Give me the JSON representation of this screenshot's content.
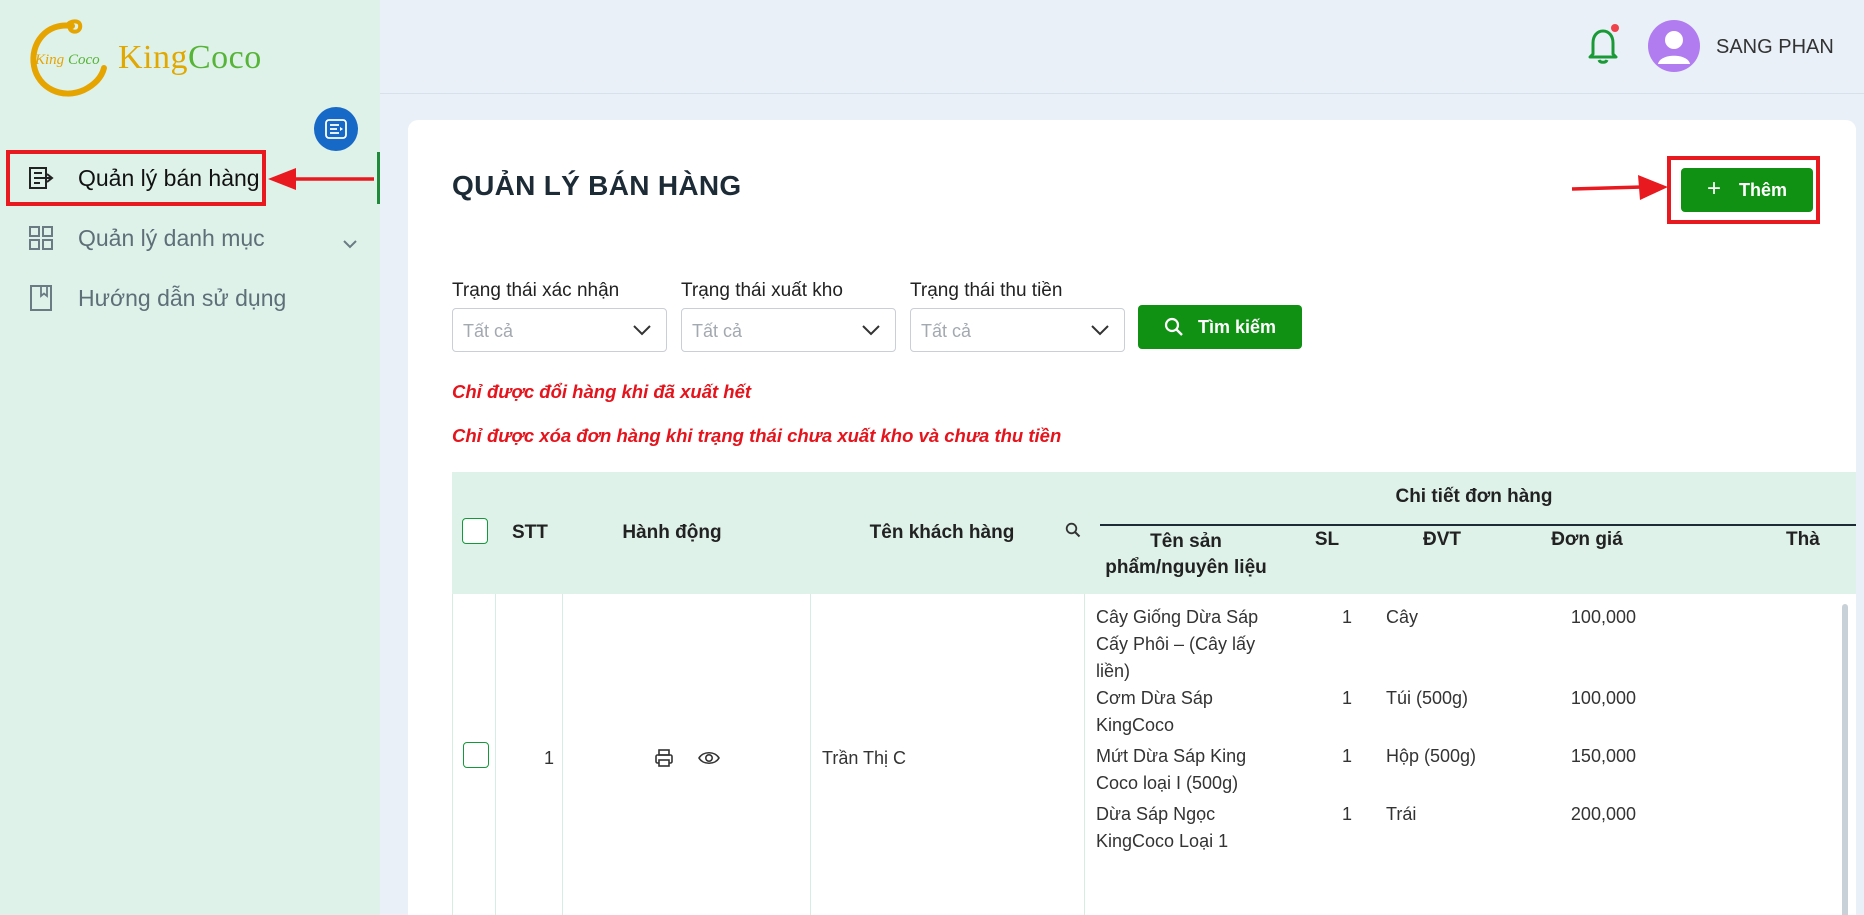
{
  "brand": {
    "logo_word_1": "King",
    "logo_word_2": "Coco",
    "mark_text": "KingCoco"
  },
  "sidebar": {
    "items": [
      {
        "label": "Quản lý bán hàng",
        "icon": "invoice-icon"
      },
      {
        "label": "Quản lý danh mục",
        "icon": "grid-icon"
      },
      {
        "label": "Hướng dẫn sử dụng",
        "icon": "book-icon"
      }
    ]
  },
  "header": {
    "user_name": "SANG PHAN"
  },
  "main": {
    "title": "QUẢN LÝ BÁN HÀNG",
    "add_label": "Thêm",
    "filters": [
      {
        "label": "Trạng thái xác nhận",
        "placeholder": "Tất cả"
      },
      {
        "label": "Trạng thái xuất kho",
        "placeholder": "Tất cả"
      },
      {
        "label": "Trạng thái thu tiền",
        "placeholder": "Tất cả"
      }
    ],
    "search_label": "Tìm kiếm",
    "notes": [
      "Chỉ được đổi hàng khi đã xuất hết",
      "Chỉ được xóa đơn hàng khi trạng thái chưa xuất kho và chưa thu tiền"
    ]
  },
  "table": {
    "headers": {
      "stt": "STT",
      "action": "Hành động",
      "customer": "Tên khách hàng",
      "group": "Chi tiết đơn hàng",
      "product": "Tên sản phẩm/nguyên liệu",
      "qty": "SL",
      "unit": "ĐVT",
      "price": "Đơn giá",
      "total_cut": "Thà"
    },
    "rows": [
      {
        "stt": "1",
        "customer": "Trần Thị C",
        "items": [
          {
            "name": "Cây Giống Dừa Sáp Cấy Phôi – (Cây lấy liền)",
            "qty": "1",
            "unit": "Cây",
            "price": "100,000"
          },
          {
            "name": "Cơm Dừa Sáp KingCoco",
            "qty": "1",
            "unit": "Túi (500g)",
            "price": "100,000"
          },
          {
            "name": "Mứt Dừa Sáp King Coco loại I (500g)",
            "qty": "1",
            "unit": "Hộp (500g)",
            "price": "150,000"
          },
          {
            "name": "Dừa Sáp Ngọc KingCoco Loại 1",
            "qty": "1",
            "unit": "Trái",
            "price": "200,000"
          }
        ]
      }
    ]
  },
  "colors": {
    "primary_green": "#109114",
    "annotation_red": "#e8191f",
    "sidebar_bg": "#dff2ea",
    "accent_blue": "#1769c8"
  }
}
